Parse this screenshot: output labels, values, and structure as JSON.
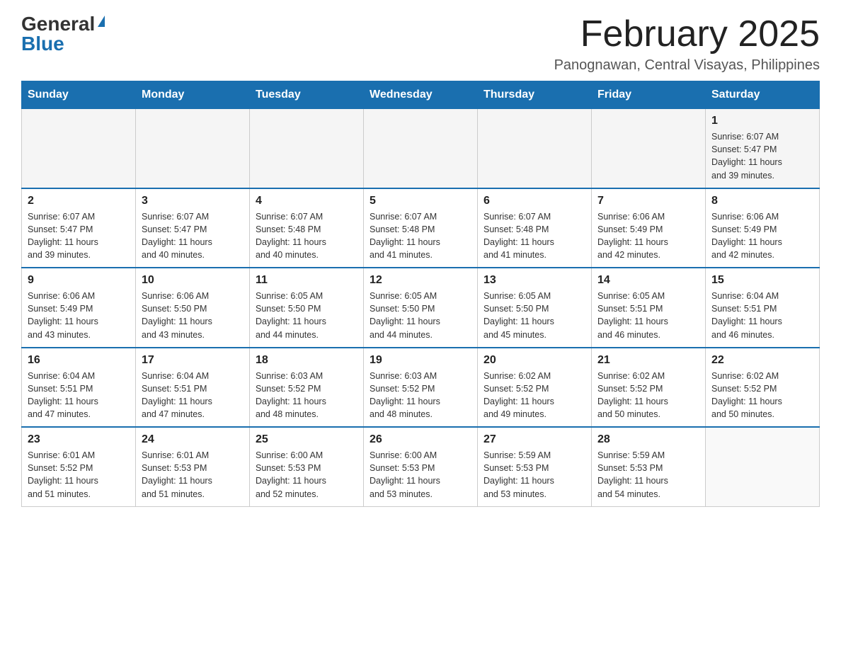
{
  "logo": {
    "general": "General",
    "blue": "Blue"
  },
  "header": {
    "title": "February 2025",
    "subtitle": "Panognawan, Central Visayas, Philippines"
  },
  "days_of_week": [
    "Sunday",
    "Monday",
    "Tuesday",
    "Wednesday",
    "Thursday",
    "Friday",
    "Saturday"
  ],
  "weeks": [
    {
      "days": [
        {
          "num": "",
          "info": ""
        },
        {
          "num": "",
          "info": ""
        },
        {
          "num": "",
          "info": ""
        },
        {
          "num": "",
          "info": ""
        },
        {
          "num": "",
          "info": ""
        },
        {
          "num": "",
          "info": ""
        },
        {
          "num": "1",
          "info": "Sunrise: 6:07 AM\nSunset: 5:47 PM\nDaylight: 11 hours\nand 39 minutes."
        }
      ]
    },
    {
      "days": [
        {
          "num": "2",
          "info": "Sunrise: 6:07 AM\nSunset: 5:47 PM\nDaylight: 11 hours\nand 39 minutes."
        },
        {
          "num": "3",
          "info": "Sunrise: 6:07 AM\nSunset: 5:47 PM\nDaylight: 11 hours\nand 40 minutes."
        },
        {
          "num": "4",
          "info": "Sunrise: 6:07 AM\nSunset: 5:48 PM\nDaylight: 11 hours\nand 40 minutes."
        },
        {
          "num": "5",
          "info": "Sunrise: 6:07 AM\nSunset: 5:48 PM\nDaylight: 11 hours\nand 41 minutes."
        },
        {
          "num": "6",
          "info": "Sunrise: 6:07 AM\nSunset: 5:48 PM\nDaylight: 11 hours\nand 41 minutes."
        },
        {
          "num": "7",
          "info": "Sunrise: 6:06 AM\nSunset: 5:49 PM\nDaylight: 11 hours\nand 42 minutes."
        },
        {
          "num": "8",
          "info": "Sunrise: 6:06 AM\nSunset: 5:49 PM\nDaylight: 11 hours\nand 42 minutes."
        }
      ]
    },
    {
      "days": [
        {
          "num": "9",
          "info": "Sunrise: 6:06 AM\nSunset: 5:49 PM\nDaylight: 11 hours\nand 43 minutes."
        },
        {
          "num": "10",
          "info": "Sunrise: 6:06 AM\nSunset: 5:50 PM\nDaylight: 11 hours\nand 43 minutes."
        },
        {
          "num": "11",
          "info": "Sunrise: 6:05 AM\nSunset: 5:50 PM\nDaylight: 11 hours\nand 44 minutes."
        },
        {
          "num": "12",
          "info": "Sunrise: 6:05 AM\nSunset: 5:50 PM\nDaylight: 11 hours\nand 44 minutes."
        },
        {
          "num": "13",
          "info": "Sunrise: 6:05 AM\nSunset: 5:50 PM\nDaylight: 11 hours\nand 45 minutes."
        },
        {
          "num": "14",
          "info": "Sunrise: 6:05 AM\nSunset: 5:51 PM\nDaylight: 11 hours\nand 46 minutes."
        },
        {
          "num": "15",
          "info": "Sunrise: 6:04 AM\nSunset: 5:51 PM\nDaylight: 11 hours\nand 46 minutes."
        }
      ]
    },
    {
      "days": [
        {
          "num": "16",
          "info": "Sunrise: 6:04 AM\nSunset: 5:51 PM\nDaylight: 11 hours\nand 47 minutes."
        },
        {
          "num": "17",
          "info": "Sunrise: 6:04 AM\nSunset: 5:51 PM\nDaylight: 11 hours\nand 47 minutes."
        },
        {
          "num": "18",
          "info": "Sunrise: 6:03 AM\nSunset: 5:52 PM\nDaylight: 11 hours\nand 48 minutes."
        },
        {
          "num": "19",
          "info": "Sunrise: 6:03 AM\nSunset: 5:52 PM\nDaylight: 11 hours\nand 48 minutes."
        },
        {
          "num": "20",
          "info": "Sunrise: 6:02 AM\nSunset: 5:52 PM\nDaylight: 11 hours\nand 49 minutes."
        },
        {
          "num": "21",
          "info": "Sunrise: 6:02 AM\nSunset: 5:52 PM\nDaylight: 11 hours\nand 50 minutes."
        },
        {
          "num": "22",
          "info": "Sunrise: 6:02 AM\nSunset: 5:52 PM\nDaylight: 11 hours\nand 50 minutes."
        }
      ]
    },
    {
      "days": [
        {
          "num": "23",
          "info": "Sunrise: 6:01 AM\nSunset: 5:52 PM\nDaylight: 11 hours\nand 51 minutes."
        },
        {
          "num": "24",
          "info": "Sunrise: 6:01 AM\nSunset: 5:53 PM\nDaylight: 11 hours\nand 51 minutes."
        },
        {
          "num": "25",
          "info": "Sunrise: 6:00 AM\nSunset: 5:53 PM\nDaylight: 11 hours\nand 52 minutes."
        },
        {
          "num": "26",
          "info": "Sunrise: 6:00 AM\nSunset: 5:53 PM\nDaylight: 11 hours\nand 53 minutes."
        },
        {
          "num": "27",
          "info": "Sunrise: 5:59 AM\nSunset: 5:53 PM\nDaylight: 11 hours\nand 53 minutes."
        },
        {
          "num": "28",
          "info": "Sunrise: 5:59 AM\nSunset: 5:53 PM\nDaylight: 11 hours\nand 54 minutes."
        },
        {
          "num": "",
          "info": ""
        }
      ]
    }
  ]
}
